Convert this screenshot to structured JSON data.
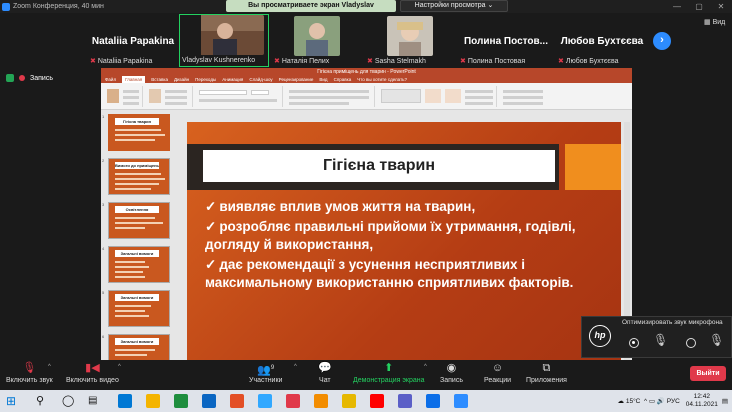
{
  "window": {
    "title": "Zoom Конференция, 40 мин",
    "share_banner": "Вы просматриваете экран Vladyslav Kushnerenko",
    "view_settings": "Настройки просмотра ⌄",
    "controls": [
      "—",
      "▢",
      "✕"
    ]
  },
  "participants": [
    {
      "display": "Nataliia Papakina",
      "label": "Nataliia Papakina",
      "video": false
    },
    {
      "display": "",
      "label": "Vladyslav Kushnerenko",
      "video": true
    },
    {
      "display": "",
      "label": "Наталія Пелих",
      "video": true
    },
    {
      "display": "",
      "label": "Sasha Stelmakh",
      "video": true
    },
    {
      "display": "Полина  Постов...",
      "label": "Полина Постовая",
      "video": false
    },
    {
      "display": "Любов Бухтєєва",
      "label": "Любов Бухтєєва",
      "video": false
    }
  ],
  "strip_next": "›",
  "view_label": "Вид",
  "recording_label": "Запись",
  "ppt": {
    "title": "Гігієна приміщень для тварин - PowerPoint",
    "tabs": [
      "Файл",
      "Главная",
      "Вставка",
      "Дизайн",
      "Переходы",
      "Анимация",
      "Слайд-шоу",
      "Рецензирование",
      "Вид",
      "Справка",
      "Что вы хотите сделать?"
    ]
  },
  "thumbnails": [
    {
      "num": "1",
      "title": "Гігієна тварин"
    },
    {
      "num": "2",
      "title": "Вимоги до приміщень"
    },
    {
      "num": "3",
      "title": "Освітлення"
    },
    {
      "num": "4",
      "title": "Загальні вимоги"
    },
    {
      "num": "5",
      "title": "Загальні вимоги"
    },
    {
      "num": "6",
      "title": "Загальні вимоги"
    },
    {
      "num": "7",
      "title": "Гігієна утримання"
    }
  ],
  "slide": {
    "title": "Гігієна тварин",
    "bullets": [
      "виявляє вплив умов життя на тварин,",
      "розробляє правильні прийоми їх утримання, годівлі, догляду й використання,",
      "дає рекомендації з усунення несприятливих і максимальному використанню сприятливих факторів."
    ],
    "check_glyph": "✓"
  },
  "toast": {
    "brand": "hp",
    "message": "Оптимизировать звук микрофона"
  },
  "toolbar": {
    "mic": "Включить звук",
    "video": "Включить видео",
    "participants": "Участники",
    "participants_count": "9",
    "chat": "Чат",
    "share": "Демонстрация экрана",
    "record": "Запись",
    "reactions": "Реакции",
    "apps": "Приложения",
    "leave": "Выйти"
  },
  "taskbar": {
    "weather": "15°C",
    "lang": "РУС",
    "time": "12:42",
    "date": "04.11.2021",
    "app_colors": [
      "#0078d4",
      "#f4b400",
      "#1e8e3e",
      "#0a66c2",
      "#e34f26",
      "#31a8ff",
      "#e0394a",
      "#f28c00",
      "#e6b800",
      "#ff0000",
      "#5b5fc7",
      "#0b6ee8",
      "#2d8cff"
    ]
  }
}
